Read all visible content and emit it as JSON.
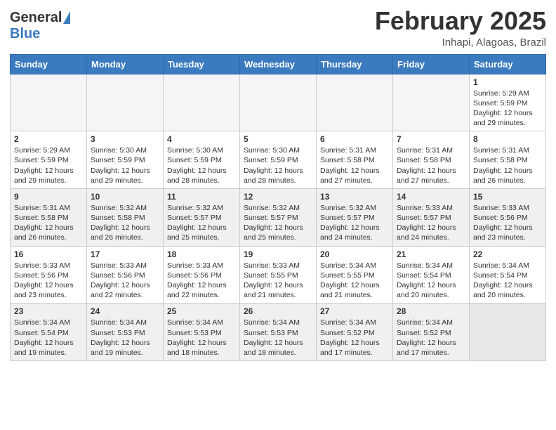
{
  "header": {
    "logo_general": "General",
    "logo_blue": "Blue",
    "month_title": "February 2025",
    "location": "Inhapi, Alagoas, Brazil"
  },
  "days_of_week": [
    "Sunday",
    "Monday",
    "Tuesday",
    "Wednesday",
    "Thursday",
    "Friday",
    "Saturday"
  ],
  "weeks": [
    {
      "shaded": false,
      "days": [
        {
          "num": "",
          "info": ""
        },
        {
          "num": "",
          "info": ""
        },
        {
          "num": "",
          "info": ""
        },
        {
          "num": "",
          "info": ""
        },
        {
          "num": "",
          "info": ""
        },
        {
          "num": "",
          "info": ""
        },
        {
          "num": "1",
          "info": "Sunrise: 5:29 AM\nSunset: 5:59 PM\nDaylight: 12 hours\nand 29 minutes."
        }
      ]
    },
    {
      "shaded": false,
      "days": [
        {
          "num": "2",
          "info": "Sunrise: 5:29 AM\nSunset: 5:59 PM\nDaylight: 12 hours\nand 29 minutes."
        },
        {
          "num": "3",
          "info": "Sunrise: 5:30 AM\nSunset: 5:59 PM\nDaylight: 12 hours\nand 29 minutes."
        },
        {
          "num": "4",
          "info": "Sunrise: 5:30 AM\nSunset: 5:59 PM\nDaylight: 12 hours\nand 28 minutes."
        },
        {
          "num": "5",
          "info": "Sunrise: 5:30 AM\nSunset: 5:59 PM\nDaylight: 12 hours\nand 28 minutes."
        },
        {
          "num": "6",
          "info": "Sunrise: 5:31 AM\nSunset: 5:58 PM\nDaylight: 12 hours\nand 27 minutes."
        },
        {
          "num": "7",
          "info": "Sunrise: 5:31 AM\nSunset: 5:58 PM\nDaylight: 12 hours\nand 27 minutes."
        },
        {
          "num": "8",
          "info": "Sunrise: 5:31 AM\nSunset: 5:58 PM\nDaylight: 12 hours\nand 26 minutes."
        }
      ]
    },
    {
      "shaded": true,
      "days": [
        {
          "num": "9",
          "info": "Sunrise: 5:31 AM\nSunset: 5:58 PM\nDaylight: 12 hours\nand 26 minutes."
        },
        {
          "num": "10",
          "info": "Sunrise: 5:32 AM\nSunset: 5:58 PM\nDaylight: 12 hours\nand 26 minutes."
        },
        {
          "num": "11",
          "info": "Sunrise: 5:32 AM\nSunset: 5:57 PM\nDaylight: 12 hours\nand 25 minutes."
        },
        {
          "num": "12",
          "info": "Sunrise: 5:32 AM\nSunset: 5:57 PM\nDaylight: 12 hours\nand 25 minutes."
        },
        {
          "num": "13",
          "info": "Sunrise: 5:32 AM\nSunset: 5:57 PM\nDaylight: 12 hours\nand 24 minutes."
        },
        {
          "num": "14",
          "info": "Sunrise: 5:33 AM\nSunset: 5:57 PM\nDaylight: 12 hours\nand 24 minutes."
        },
        {
          "num": "15",
          "info": "Sunrise: 5:33 AM\nSunset: 5:56 PM\nDaylight: 12 hours\nand 23 minutes."
        }
      ]
    },
    {
      "shaded": false,
      "days": [
        {
          "num": "16",
          "info": "Sunrise: 5:33 AM\nSunset: 5:56 PM\nDaylight: 12 hours\nand 23 minutes."
        },
        {
          "num": "17",
          "info": "Sunrise: 5:33 AM\nSunset: 5:56 PM\nDaylight: 12 hours\nand 22 minutes."
        },
        {
          "num": "18",
          "info": "Sunrise: 5:33 AM\nSunset: 5:56 PM\nDaylight: 12 hours\nand 22 minutes."
        },
        {
          "num": "19",
          "info": "Sunrise: 5:33 AM\nSunset: 5:55 PM\nDaylight: 12 hours\nand 21 minutes."
        },
        {
          "num": "20",
          "info": "Sunrise: 5:34 AM\nSunset: 5:55 PM\nDaylight: 12 hours\nand 21 minutes."
        },
        {
          "num": "21",
          "info": "Sunrise: 5:34 AM\nSunset: 5:54 PM\nDaylight: 12 hours\nand 20 minutes."
        },
        {
          "num": "22",
          "info": "Sunrise: 5:34 AM\nSunset: 5:54 PM\nDaylight: 12 hours\nand 20 minutes."
        }
      ]
    },
    {
      "shaded": true,
      "days": [
        {
          "num": "23",
          "info": "Sunrise: 5:34 AM\nSunset: 5:54 PM\nDaylight: 12 hours\nand 19 minutes."
        },
        {
          "num": "24",
          "info": "Sunrise: 5:34 AM\nSunset: 5:53 PM\nDaylight: 12 hours\nand 19 minutes."
        },
        {
          "num": "25",
          "info": "Sunrise: 5:34 AM\nSunset: 5:53 PM\nDaylight: 12 hours\nand 18 minutes."
        },
        {
          "num": "26",
          "info": "Sunrise: 5:34 AM\nSunset: 5:53 PM\nDaylight: 12 hours\nand 18 minutes."
        },
        {
          "num": "27",
          "info": "Sunrise: 5:34 AM\nSunset: 5:52 PM\nDaylight: 12 hours\nand 17 minutes."
        },
        {
          "num": "28",
          "info": "Sunrise: 5:34 AM\nSunset: 5:52 PM\nDaylight: 12 hours\nand 17 minutes."
        },
        {
          "num": "",
          "info": ""
        }
      ]
    }
  ]
}
